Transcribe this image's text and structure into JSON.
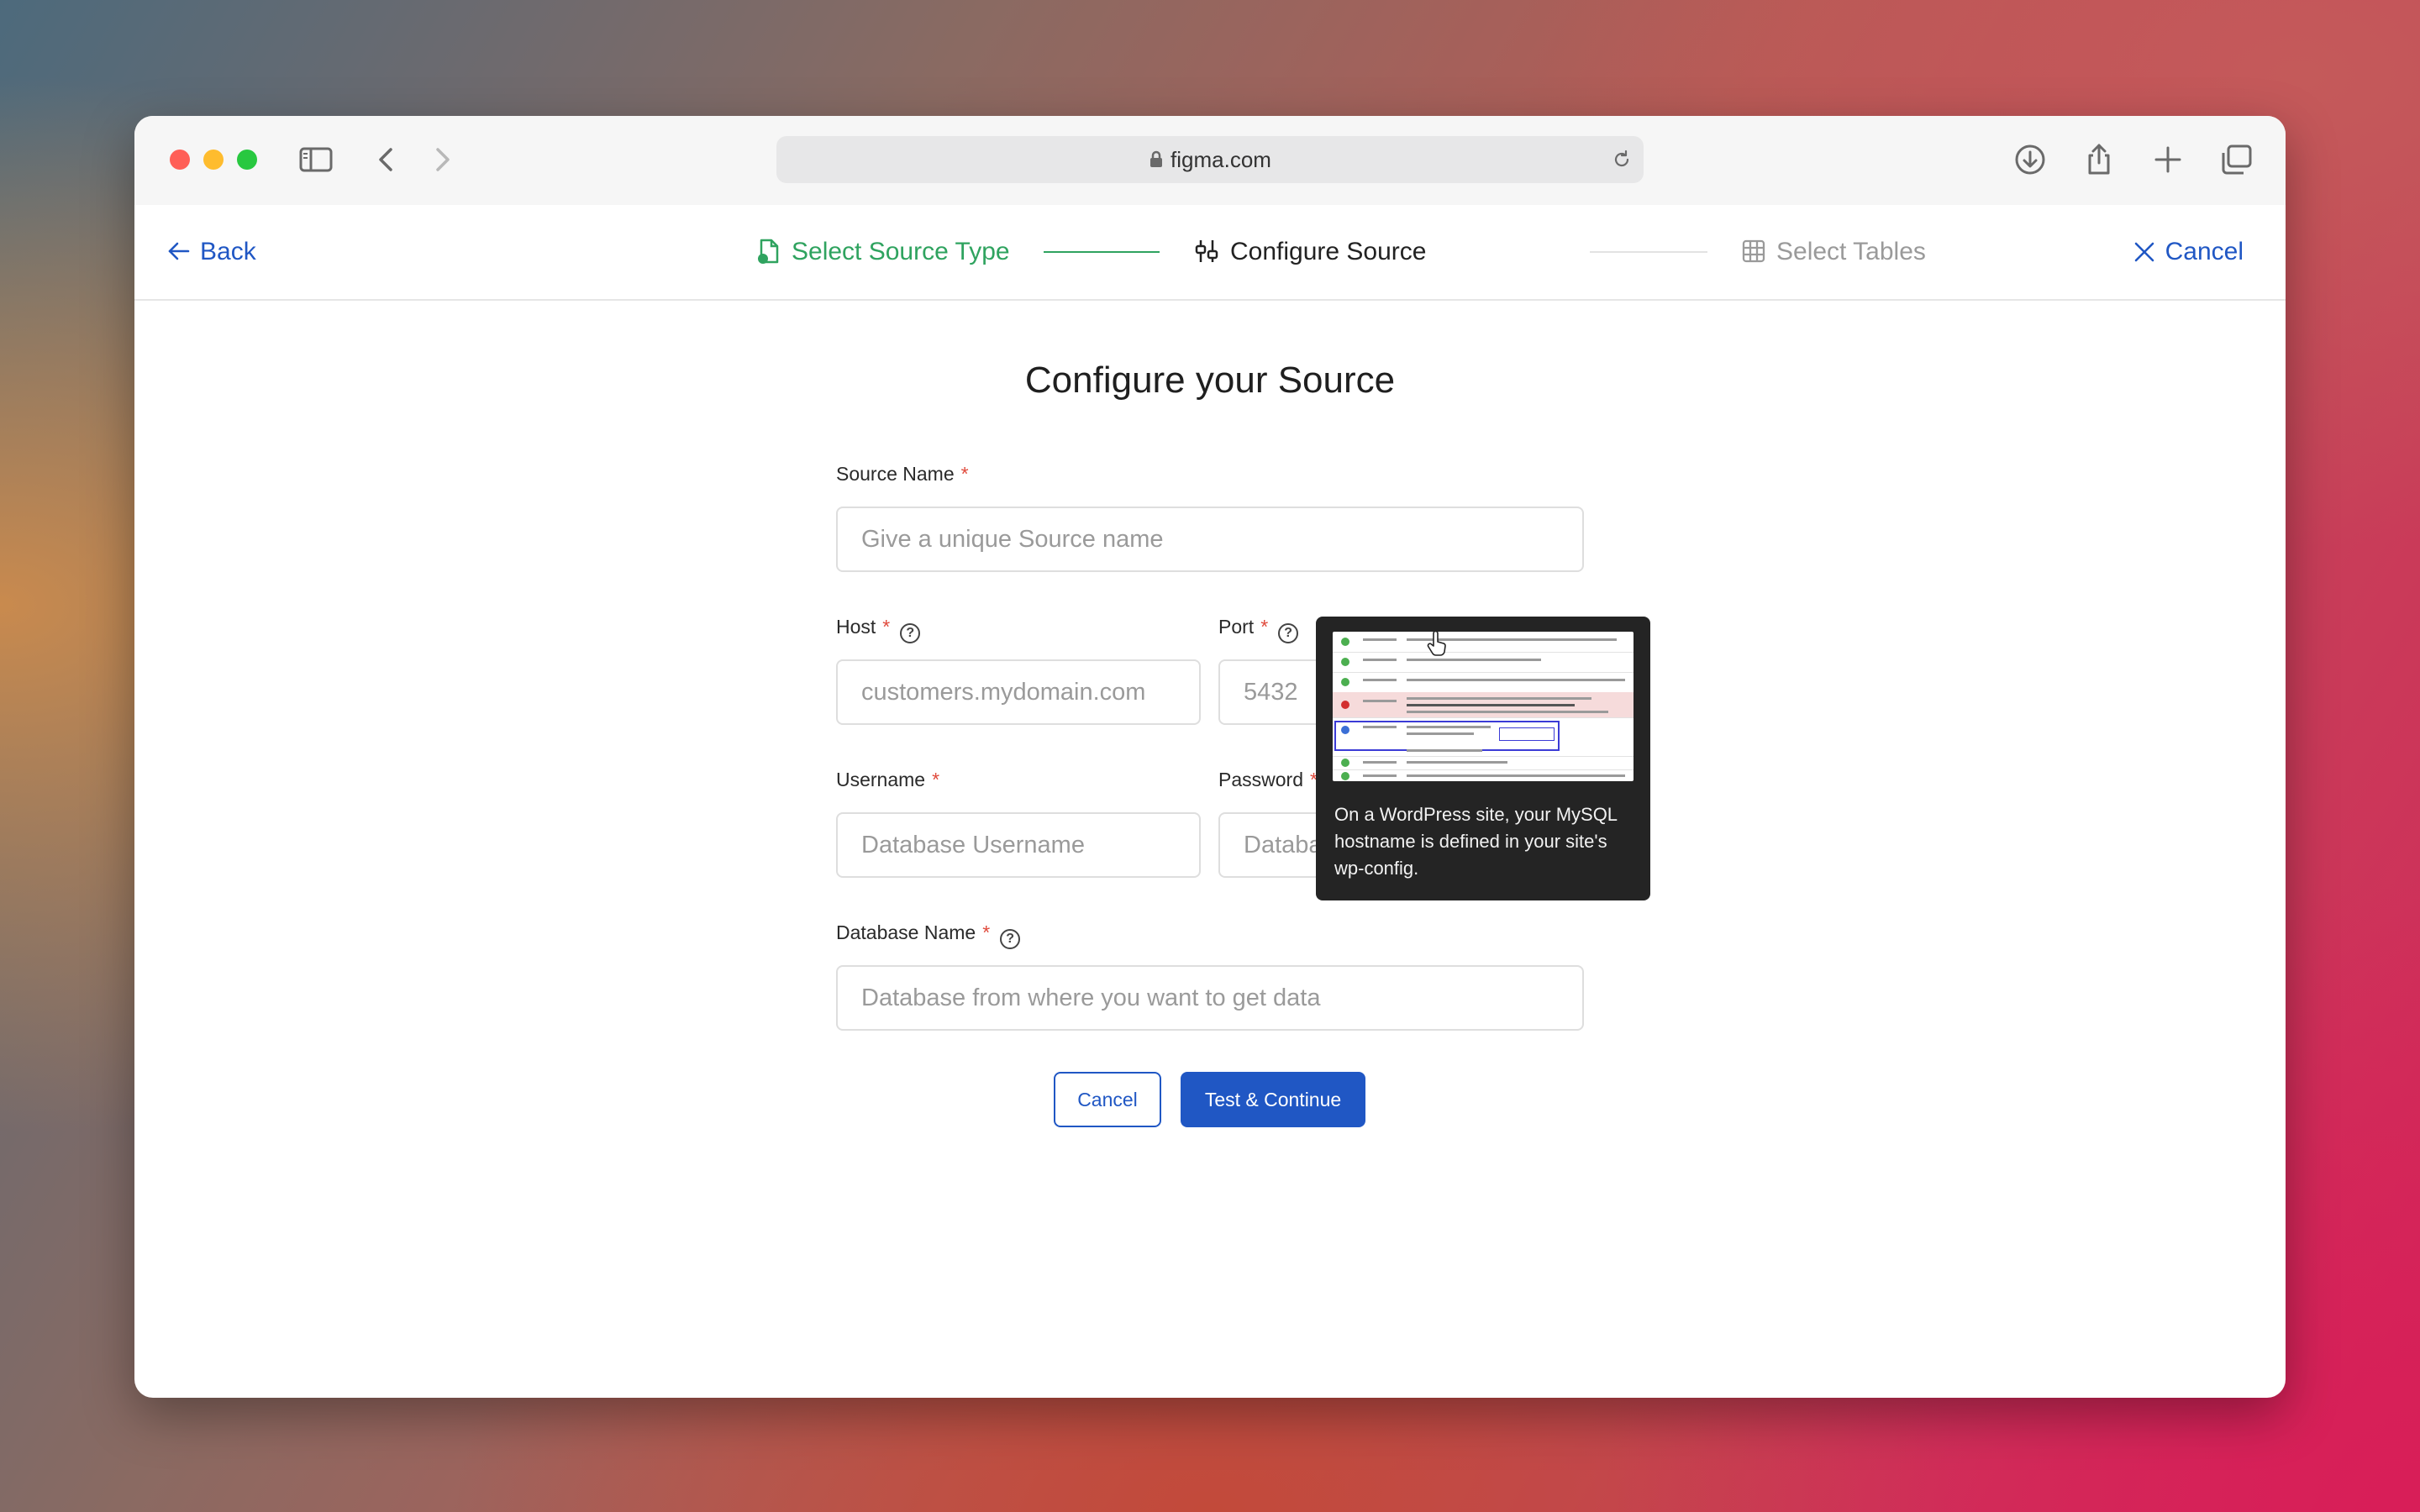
{
  "browser": {
    "url": "figma.com",
    "traffic_colors": {
      "close": "#ff5f57",
      "minimize": "#febc2e",
      "zoom": "#28c840"
    }
  },
  "header": {
    "back_label": "Back",
    "cancel_label": "Cancel",
    "steps": [
      {
        "label": "Select Source Type",
        "state": "complete",
        "color": "#2fa35f"
      },
      {
        "label": "Configure Source",
        "state": "current",
        "color": "#222222"
      },
      {
        "label": "Select Tables",
        "state": "upcoming",
        "color": "#9a9a9a"
      }
    ]
  },
  "form": {
    "title": "Configure your Source",
    "source_name": {
      "label": "Source Name",
      "placeholder": "Give a unique Source name"
    },
    "host": {
      "label": "Host",
      "placeholder": "customers.mydomain.com"
    },
    "port": {
      "label": "Port",
      "placeholder": "5432"
    },
    "username": {
      "label": "Username",
      "placeholder": "Database Username"
    },
    "password": {
      "label": "Password",
      "placeholder": "Database Password"
    },
    "database_name": {
      "label": "Database Name",
      "placeholder": "Database from where you want to get data"
    },
    "required_mark": "*",
    "help_glyph": "?",
    "cancel_button": "Cancel",
    "submit_button": "Test & Continue"
  },
  "tooltip": {
    "text": "On a WordPress site, your MySQL hostname is defined in your site's wp-config."
  },
  "colors": {
    "accent": "#2057c4",
    "complete": "#2fa35f",
    "required": "#e04a3c"
  }
}
